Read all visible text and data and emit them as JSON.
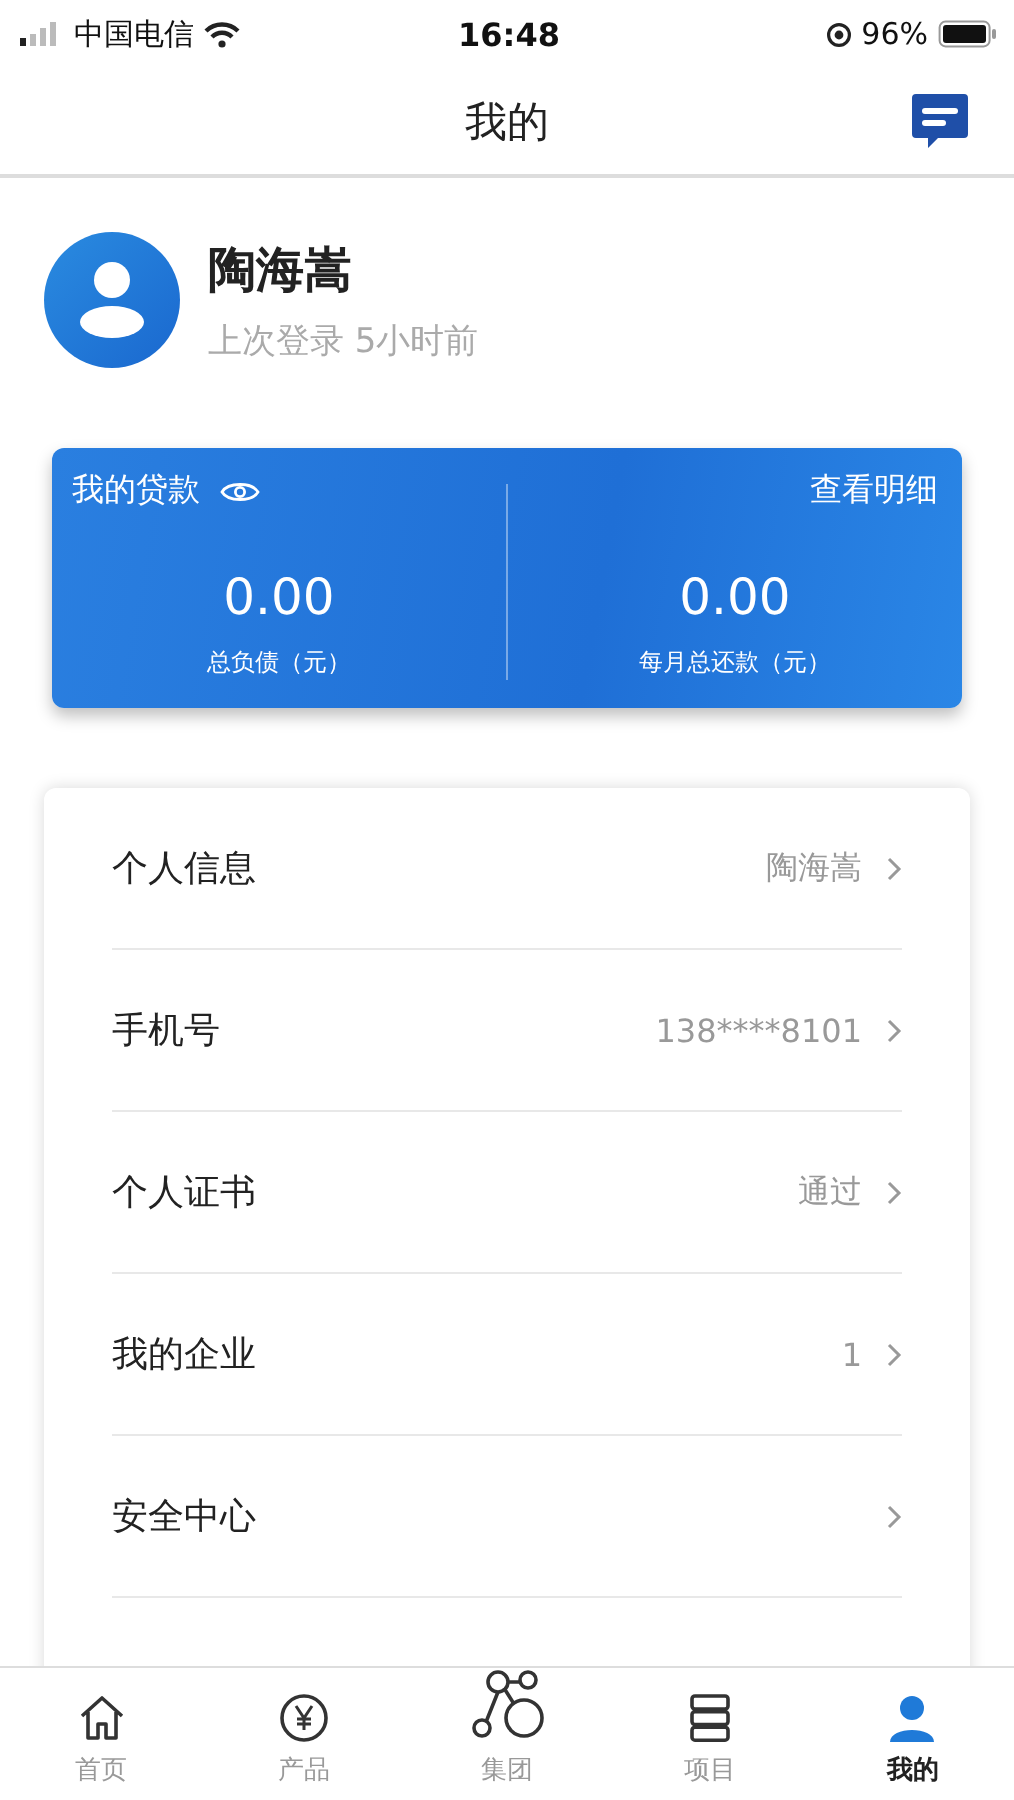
{
  "status_bar": {
    "carrier": "中国电信",
    "time": "16:48",
    "battery": "96%"
  },
  "header": {
    "title": "我的"
  },
  "profile": {
    "name": "陶海嵩",
    "last_login": "上次登录 5小时前"
  },
  "loan_card": {
    "title": "我的贷款",
    "link": "查看明细",
    "stats": [
      {
        "value": "0.00",
        "label": "总负债（元）"
      },
      {
        "value": "0.00",
        "label": "每月总还款（元）"
      }
    ]
  },
  "menu": [
    {
      "label": "个人信息",
      "value": "陶海嵩"
    },
    {
      "label": "手机号",
      "value": "138****8101"
    },
    {
      "label": "个人证书",
      "value": "通过"
    },
    {
      "label": "我的企业",
      "value": "1"
    },
    {
      "label": "安全中心"
    }
  ],
  "tabs": [
    {
      "label": "首页",
      "selected": false
    },
    {
      "label": "产品",
      "selected": false
    },
    {
      "label": "集团",
      "selected": false
    },
    {
      "label": "项目",
      "selected": false
    },
    {
      "label": "我的",
      "selected": true
    }
  ]
}
